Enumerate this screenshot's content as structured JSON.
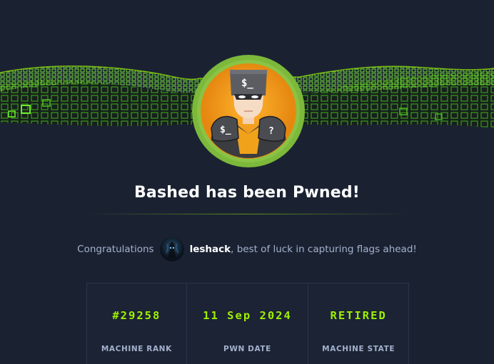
{
  "title": "Bashed has been Pwned!",
  "congrats": {
    "prefix": "Congratulations",
    "username": "leshack",
    "suffix": ", best of luck in capturing flags ahead!"
  },
  "stats": [
    {
      "value": "#29258",
      "label": "MACHINE RANK"
    },
    {
      "value": "11 Sep 2024",
      "label": "PWN DATE"
    },
    {
      "value": "RETIRED",
      "label": "MACHINE STATE"
    }
  ],
  "colors": {
    "background": "#1a2232",
    "accent": "#9fef00",
    "text_muted": "#a4b1cd",
    "avatar_ring": "#86c13b",
    "avatar_fill": "#f29b12"
  },
  "icons": {
    "machine_avatar": "bashed-machine-avatar",
    "user_avatar": "user-avatar",
    "banner": "green-cube-wave-banner"
  }
}
